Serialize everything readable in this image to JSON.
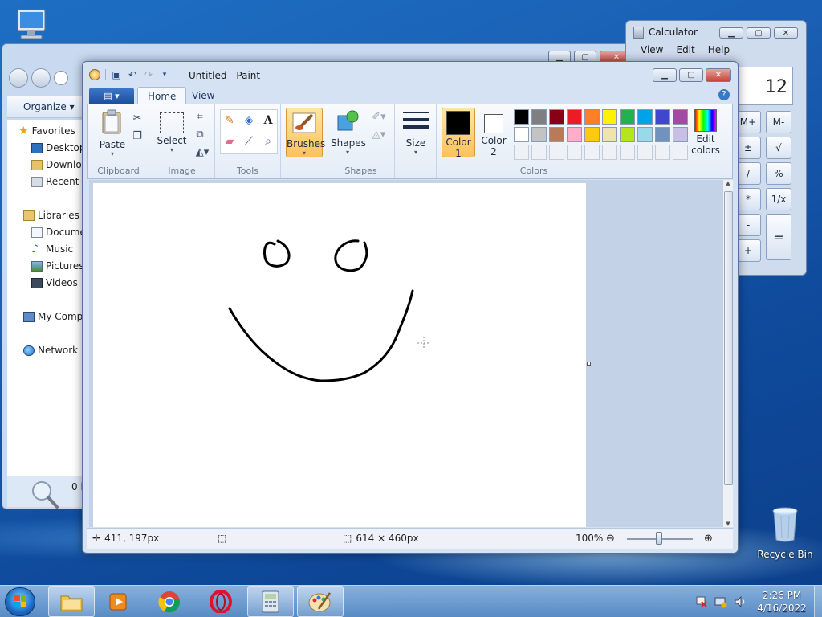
{
  "desktop": {
    "recycle_bin_label": "Recycle Bin"
  },
  "explorer": {
    "organize_label": "Organize",
    "nav": {
      "favorites": "Favorites",
      "desktop": "Desktop",
      "downloads": "Downlo",
      "recent": "Recent P",
      "libraries": "Libraries",
      "documents": "Docume",
      "music": "Music",
      "pictures": "Pictures",
      "videos": "Videos",
      "computer": "My Comp",
      "network": "Network"
    },
    "details_text": "0 i"
  },
  "calculator": {
    "title": "Calculator",
    "menu": [
      "View",
      "Edit",
      "Help"
    ],
    "display": "12",
    "keys": [
      "M+",
      "M-",
      "±",
      "√",
      "/",
      "%",
      "*",
      "1/x",
      "-",
      "=",
      "+"
    ]
  },
  "paint": {
    "title": "Untitled - Paint",
    "tabs": {
      "home": "Home",
      "view": "View"
    },
    "ribbon": {
      "clipboard": {
        "label": "Clipboard",
        "paste": "Paste"
      },
      "image": {
        "label": "Image",
        "select": "Select"
      },
      "tools": {
        "label": "Tools"
      },
      "brushes": "Brushes",
      "shapes": {
        "label": "Shapes",
        "button": "Shapes"
      },
      "size": "Size",
      "color1": [
        "Color",
        "1"
      ],
      "color2": [
        "Color",
        "2"
      ],
      "colors_label": "Colors",
      "edit_colors": [
        "Edit",
        "colors"
      ]
    },
    "palette_row1": [
      "#000000",
      "#7f7f7f",
      "#880015",
      "#ed1c24",
      "#ff7f27",
      "#fff200",
      "#22b14c",
      "#00a2e8",
      "#3f48cc",
      "#a349a4"
    ],
    "palette_row2": [
      "#ffffff",
      "#c3c3c3",
      "#b97a57",
      "#ffaec9",
      "#ffc90e",
      "#efe4b0",
      "#b5e61d",
      "#99d9ea",
      "#7092be",
      "#c8bfe7"
    ],
    "color1": "#000000",
    "color2": "#ffffff",
    "status": {
      "cursor_pos": "411, 197px",
      "canvas_size": "614 × 460px",
      "zoom": "100%"
    }
  },
  "taskbar": {
    "time": "2:26 PM",
    "date": "4/16/2022"
  }
}
